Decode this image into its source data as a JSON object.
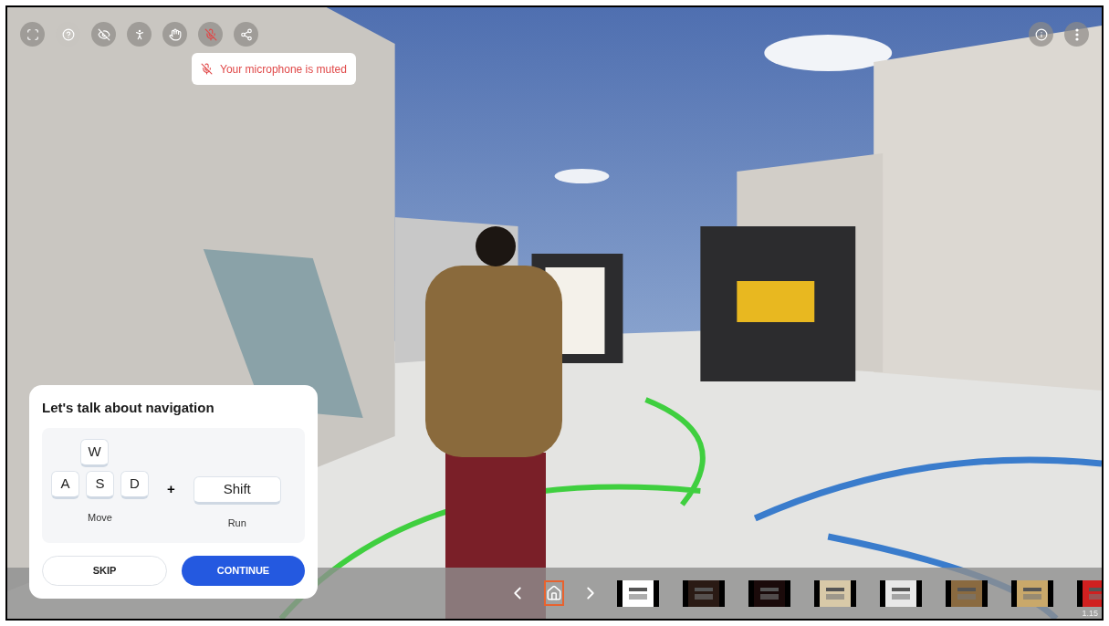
{
  "toolbar": [
    {
      "kind": "fullscreen",
      "active": false
    },
    {
      "kind": "help",
      "active": true
    },
    {
      "kind": "visibility",
      "active": false
    },
    {
      "kind": "avatar",
      "active": false
    },
    {
      "kind": "hand",
      "active": false
    },
    {
      "kind": "microphone",
      "active": false,
      "muted": true
    },
    {
      "kind": "share",
      "active": false
    }
  ],
  "top_right": [
    {
      "kind": "info"
    },
    {
      "kind": "more"
    }
  ],
  "toast": {
    "text": "Your microphone is muted"
  },
  "tutorial": {
    "title": "Let's talk about navigation",
    "move_keys": [
      "W",
      "A",
      "S",
      "D"
    ],
    "plus": "+",
    "run_key": "Shift",
    "move_label": "Move",
    "run_label": "Run",
    "skip": "SKIP",
    "continue": "CONTINUE"
  },
  "filmstrip": {
    "home": {
      "selected": true
    }
  },
  "version": "1.15"
}
